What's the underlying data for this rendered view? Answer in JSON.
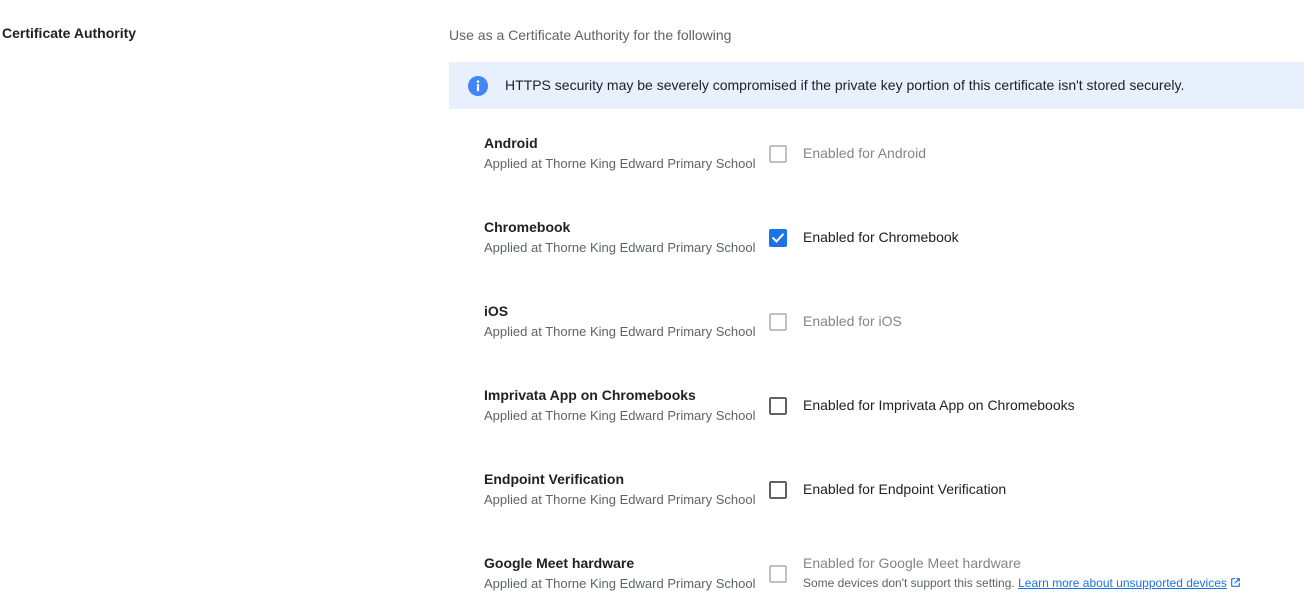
{
  "section": {
    "title": "Certificate Authority",
    "description": "Use as a Certificate Authority for the following"
  },
  "banner": {
    "icon": "info-icon",
    "text": "HTTPS security may be severely compromised if the private key portion of this certificate isn't stored securely."
  },
  "colors": {
    "accent": "#1a73e8",
    "banner_bg": "#e8f0fe",
    "disabled": "#bdc1c6"
  },
  "rows": [
    {
      "title": "Android",
      "subtitle": "Applied at Thorne King Edward Primary School",
      "label": "Enabled for Android",
      "checked": false,
      "disabled": true
    },
    {
      "title": "Chromebook",
      "subtitle": "Applied at Thorne King Edward Primary School",
      "label": "Enabled for Chromebook",
      "checked": true,
      "disabled": false
    },
    {
      "title": "iOS",
      "subtitle": "Applied at Thorne King Edward Primary School",
      "label": "Enabled for iOS",
      "checked": false,
      "disabled": true
    },
    {
      "title": "Imprivata App on Chromebooks",
      "subtitle": "Applied at Thorne King Edward Primary School",
      "label": "Enabled for Imprivata App on Chromebooks",
      "checked": false,
      "disabled": false
    },
    {
      "title": "Endpoint Verification",
      "subtitle": "Applied at Thorne King Edward Primary School",
      "label": "Enabled for Endpoint Verification",
      "checked": false,
      "disabled": false
    },
    {
      "title": "Google Meet hardware",
      "subtitle": "Applied at Thorne King Edward Primary School",
      "label": "Enabled for Google Meet hardware",
      "checked": false,
      "disabled": true,
      "note": "Some devices don't support this setting.",
      "note_link": "Learn more about unsupported devices"
    }
  ]
}
